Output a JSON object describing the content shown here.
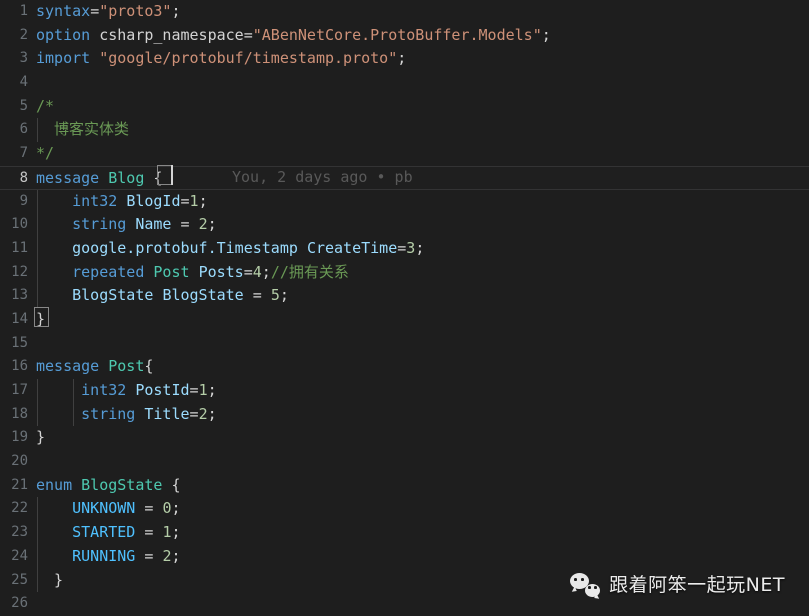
{
  "editor": {
    "language": "protobuf",
    "theme": "dark-plus",
    "background": "#1e1e1e",
    "current_line": 8,
    "blame_annotation": "You, 2 days ago • pb",
    "colors": {
      "keyword": "#569cd6",
      "string": "#ce9178",
      "type": "#4ec9b0",
      "identifier": "#9cdcfe",
      "number": "#b5cea8",
      "comment": "#6a9955",
      "punctuation": "#d4d4d4",
      "enum_member": "#4fc1ff",
      "line_number": "#6a7177",
      "blame_text": "#595959"
    },
    "lines": [
      {
        "n": "1",
        "indent": 0,
        "tokens": [
          {
            "t": "syntax",
            "c": "kw"
          },
          {
            "t": "=",
            "c": "punc"
          },
          {
            "t": "\"proto3\"",
            "c": "str"
          },
          {
            "t": ";",
            "c": "punc"
          }
        ]
      },
      {
        "n": "2",
        "indent": 0,
        "tokens": [
          {
            "t": "option",
            "c": "kw"
          },
          {
            "t": " ",
            "c": "plain"
          },
          {
            "t": "csharp_namespace",
            "c": "plain"
          },
          {
            "t": "=",
            "c": "punc"
          },
          {
            "t": "\"ABenNetCore.ProtoBuffer.Models\"",
            "c": "str"
          },
          {
            "t": ";",
            "c": "punc"
          }
        ]
      },
      {
        "n": "3",
        "indent": 0,
        "tokens": [
          {
            "t": "import",
            "c": "kw"
          },
          {
            "t": " ",
            "c": "plain"
          },
          {
            "t": "\"google/protobuf/timestamp.proto\"",
            "c": "str"
          },
          {
            "t": ";",
            "c": "punc"
          }
        ]
      },
      {
        "n": "4",
        "indent": 0,
        "tokens": []
      },
      {
        "n": "5",
        "indent": 0,
        "tokens": [
          {
            "t": "/*",
            "c": "com"
          }
        ]
      },
      {
        "n": "6",
        "indent": 1,
        "tokens": [
          {
            "t": "  博客实体类",
            "c": "com"
          }
        ]
      },
      {
        "n": "7",
        "indent": 0,
        "tokens": [
          {
            "t": "*/",
            "c": "com"
          }
        ]
      },
      {
        "n": "8",
        "indent": 0,
        "tokens": [
          {
            "t": "message",
            "c": "kw"
          },
          {
            "t": " ",
            "c": "plain"
          },
          {
            "t": "Blog",
            "c": "type"
          },
          {
            "t": " ",
            "c": "plain"
          },
          {
            "t": "{",
            "c": "punc"
          }
        ]
      },
      {
        "n": "9",
        "indent": 1,
        "tokens": [
          {
            "t": "    ",
            "c": "plain"
          },
          {
            "t": "int32",
            "c": "kw"
          },
          {
            "t": " ",
            "c": "plain"
          },
          {
            "t": "BlogId",
            "c": "ident"
          },
          {
            "t": "=",
            "c": "punc"
          },
          {
            "t": "1",
            "c": "num"
          },
          {
            "t": ";",
            "c": "punc"
          }
        ]
      },
      {
        "n": "10",
        "indent": 1,
        "tokens": [
          {
            "t": "    ",
            "c": "plain"
          },
          {
            "t": "string",
            "c": "kw"
          },
          {
            "t": " ",
            "c": "plain"
          },
          {
            "t": "Name",
            "c": "ident"
          },
          {
            "t": " = ",
            "c": "punc"
          },
          {
            "t": "2",
            "c": "num"
          },
          {
            "t": ";",
            "c": "punc"
          }
        ]
      },
      {
        "n": "11",
        "indent": 1,
        "tokens": [
          {
            "t": "    ",
            "c": "plain"
          },
          {
            "t": "google.protobuf.Timestamp",
            "c": "ident"
          },
          {
            "t": " ",
            "c": "plain"
          },
          {
            "t": "CreateTime",
            "c": "ident"
          },
          {
            "t": "=",
            "c": "punc"
          },
          {
            "t": "3",
            "c": "num"
          },
          {
            "t": ";",
            "c": "punc"
          }
        ]
      },
      {
        "n": "12",
        "indent": 1,
        "tokens": [
          {
            "t": "    ",
            "c": "plain"
          },
          {
            "t": "repeated",
            "c": "kw"
          },
          {
            "t": " ",
            "c": "plain"
          },
          {
            "t": "Post",
            "c": "type"
          },
          {
            "t": " ",
            "c": "plain"
          },
          {
            "t": "Posts",
            "c": "ident"
          },
          {
            "t": "=",
            "c": "punc"
          },
          {
            "t": "4",
            "c": "num"
          },
          {
            "t": ";",
            "c": "punc"
          },
          {
            "t": "//拥有关系",
            "c": "com"
          }
        ]
      },
      {
        "n": "13",
        "indent": 1,
        "tokens": [
          {
            "t": "    ",
            "c": "plain"
          },
          {
            "t": "BlogState",
            "c": "ident"
          },
          {
            "t": " ",
            "c": "plain"
          },
          {
            "t": "BlogState",
            "c": "ident"
          },
          {
            "t": " = ",
            "c": "punc"
          },
          {
            "t": "5",
            "c": "num"
          },
          {
            "t": ";",
            "c": "punc"
          }
        ]
      },
      {
        "n": "14",
        "indent": 0,
        "tokens": [
          {
            "t": "}",
            "c": "punc"
          }
        ]
      },
      {
        "n": "15",
        "indent": 0,
        "tokens": []
      },
      {
        "n": "16",
        "indent": 0,
        "tokens": [
          {
            "t": "message",
            "c": "kw"
          },
          {
            "t": " ",
            "c": "plain"
          },
          {
            "t": "Post",
            "c": "type"
          },
          {
            "t": "{",
            "c": "punc"
          }
        ]
      },
      {
        "n": "17",
        "indent": 2,
        "tokens": [
          {
            "t": "     ",
            "c": "plain"
          },
          {
            "t": "int32",
            "c": "kw"
          },
          {
            "t": " ",
            "c": "plain"
          },
          {
            "t": "PostId",
            "c": "ident"
          },
          {
            "t": "=",
            "c": "punc"
          },
          {
            "t": "1",
            "c": "num"
          },
          {
            "t": ";",
            "c": "punc"
          }
        ]
      },
      {
        "n": "18",
        "indent": 2,
        "tokens": [
          {
            "t": "     ",
            "c": "plain"
          },
          {
            "t": "string",
            "c": "kw"
          },
          {
            "t": " ",
            "c": "plain"
          },
          {
            "t": "Title",
            "c": "ident"
          },
          {
            "t": "=",
            "c": "punc"
          },
          {
            "t": "2",
            "c": "num"
          },
          {
            "t": ";",
            "c": "punc"
          }
        ]
      },
      {
        "n": "19",
        "indent": 0,
        "tokens": [
          {
            "t": "}",
            "c": "punc"
          }
        ]
      },
      {
        "n": "20",
        "indent": 0,
        "tokens": []
      },
      {
        "n": "21",
        "indent": 0,
        "tokens": [
          {
            "t": "enum",
            "c": "kw"
          },
          {
            "t": " ",
            "c": "plain"
          },
          {
            "t": "BlogState",
            "c": "type"
          },
          {
            "t": " ",
            "c": "plain"
          },
          {
            "t": "{",
            "c": "punc"
          }
        ]
      },
      {
        "n": "22",
        "indent": 1,
        "tokens": [
          {
            "t": "    ",
            "c": "plain"
          },
          {
            "t": "UNKNOWN",
            "c": "enumval"
          },
          {
            "t": " = ",
            "c": "punc"
          },
          {
            "t": "0",
            "c": "num"
          },
          {
            "t": ";",
            "c": "punc"
          }
        ]
      },
      {
        "n": "23",
        "indent": 1,
        "tokens": [
          {
            "t": "    ",
            "c": "plain"
          },
          {
            "t": "STARTED",
            "c": "enumval"
          },
          {
            "t": " = ",
            "c": "punc"
          },
          {
            "t": "1",
            "c": "num"
          },
          {
            "t": ";",
            "c": "punc"
          }
        ]
      },
      {
        "n": "24",
        "indent": 1,
        "tokens": [
          {
            "t": "    ",
            "c": "plain"
          },
          {
            "t": "RUNNING",
            "c": "enumval"
          },
          {
            "t": " = ",
            "c": "punc"
          },
          {
            "t": "2",
            "c": "num"
          },
          {
            "t": ";",
            "c": "punc"
          }
        ]
      },
      {
        "n": "25",
        "indent": 1,
        "tokens": [
          {
            "t": "  }",
            "c": "punc"
          }
        ]
      },
      {
        "n": "26",
        "indent": 0,
        "tokens": []
      }
    ]
  },
  "watermark": {
    "icon": "wechat-icon",
    "text": "跟着阿笨一起玩NET"
  }
}
